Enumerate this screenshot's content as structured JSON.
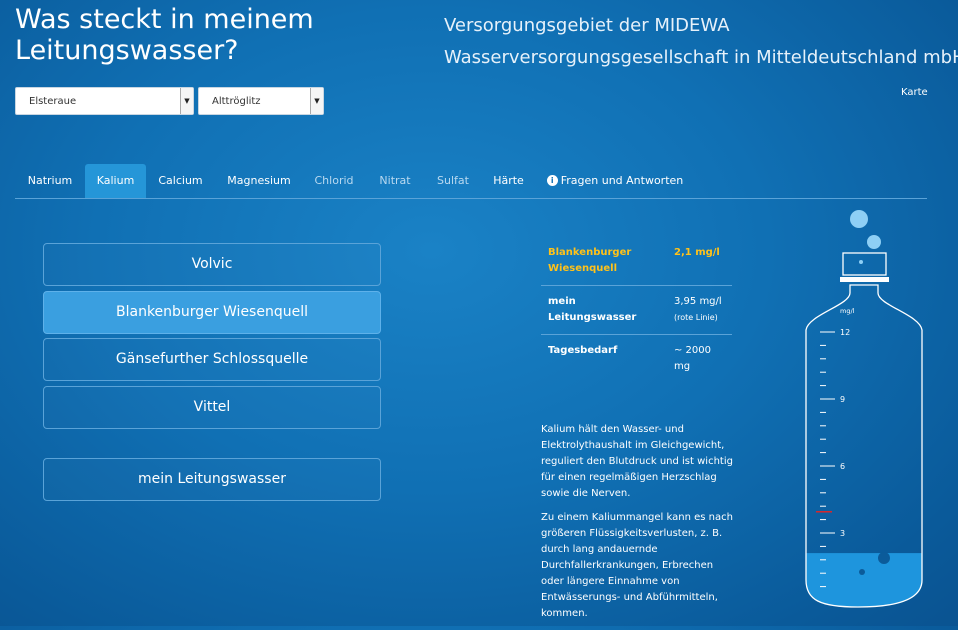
{
  "header": {
    "title_line1": "Was steckt in meinem",
    "title_line2": "Leitungswasser?",
    "provider_line1": "Versorgungsgebiet der MIDEWA",
    "provider_line2": "Wasserversorgungsgesellschaft in Mitteldeutschland mbH",
    "map_link": "Karte"
  },
  "selects": {
    "region": "Elsteraue",
    "locality": "Alttröglitz"
  },
  "tabs": [
    {
      "label": "Natrium"
    },
    {
      "label": "Kalium"
    },
    {
      "label": "Calcium"
    },
    {
      "label": "Magnesium"
    },
    {
      "label": "Chlorid"
    },
    {
      "label": "Nitrat"
    },
    {
      "label": "Sulfat"
    },
    {
      "label": "Härte"
    },
    {
      "label": "Fragen und Antworten",
      "icon": "info-icon"
    }
  ],
  "active_tab": "Kalium",
  "waters": [
    {
      "label": "Volvic"
    },
    {
      "label": "Blankenburger Wiesenquell"
    },
    {
      "label": "Gänsefurther Schlossquelle"
    },
    {
      "label": "Vittel"
    }
  ],
  "selected_water": "Blankenburger Wiesenquell",
  "tap_water_button": "mein Leitungswasser",
  "comparison": {
    "selected_name": "Blankenburger Wiesenquell",
    "selected_value": "2,1 mg/l",
    "tap_label": "mein Leitungswasser",
    "tap_value": "3,95 mg/l",
    "tap_note": "(rote Linie)",
    "daily_label": "Tagesbedarf",
    "daily_value": "~ 2000 mg",
    "highlight_color": "#ffc21a"
  },
  "description": [
    "Kalium hält den Wasser- und Elektrolythaushalt im Gleichgewicht, reguliert den Blutdruck und ist wichtig für einen regelmäßigen Herzschlag sowie die Nerven.",
    "Zu einem Kaliummangel kann es nach größeren Flüssigkeitsverlusten, z. B. durch lang andauernde Durchfallerkrankungen, Erbrechen oder längere Einnahme von Entwässerungs- und Abführmitteln, kommen."
  ],
  "gauge": {
    "unit": "mg/l",
    "tick_labels": [
      "12",
      "9",
      "6",
      "3"
    ],
    "scale_max": 12,
    "fill_value": 2.1,
    "red_line_value": 3.95,
    "red_line_color": "#d9262b",
    "water_color": "#1e95dd"
  }
}
